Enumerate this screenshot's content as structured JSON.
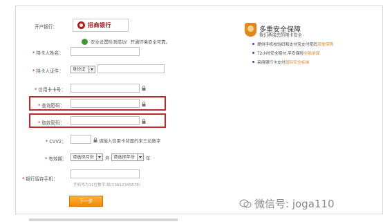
{
  "form": {
    "bank_label": "开户银行：",
    "bank_name": "招商银行",
    "security_text": "安全设置检测成功！开通环境安全可靠。",
    "holder_name_label": "持卡人姓名：",
    "holder_id_label": "持卡人证件：",
    "id_type_selected": "身份证",
    "card_number_label": "信用卡卡号：",
    "query_password_label": "查询密码：",
    "payment_password_label": "取款密码：",
    "cvv2_label": "CVV2：",
    "cvv2_hint": "请输入信用卡背面的末三位数字",
    "expiry_label": "有效期：",
    "month_selected": "请选择月份",
    "month_unit": "月",
    "year_selected": "请选择年份",
    "year_unit": "年",
    "phone_label": "银行留存手机：",
    "phone_hint": "手机号为11位数字,如(13812345678)",
    "next_button": "下一步",
    "required_mark": "*"
  },
  "panel": {
    "title": "多重安全保障",
    "subtitle": "我们承诺您的用卡安全",
    "items": [
      {
        "text": "提供手机校验码和支付宝支付密码",
        "emph": "双重保障"
      },
      {
        "text": "72小时安全赔付,平安保险",
        "emph": "全额承保"
      },
      {
        "text": "采用银行卡支付",
        "emph": "国际安全标准"
      }
    ]
  },
  "watermark": {
    "text": "微信号: joga110"
  },
  "colors": {
    "highlight_border": "#c0282a",
    "button_orange": "#f08a00",
    "required_red": "#d40000"
  }
}
